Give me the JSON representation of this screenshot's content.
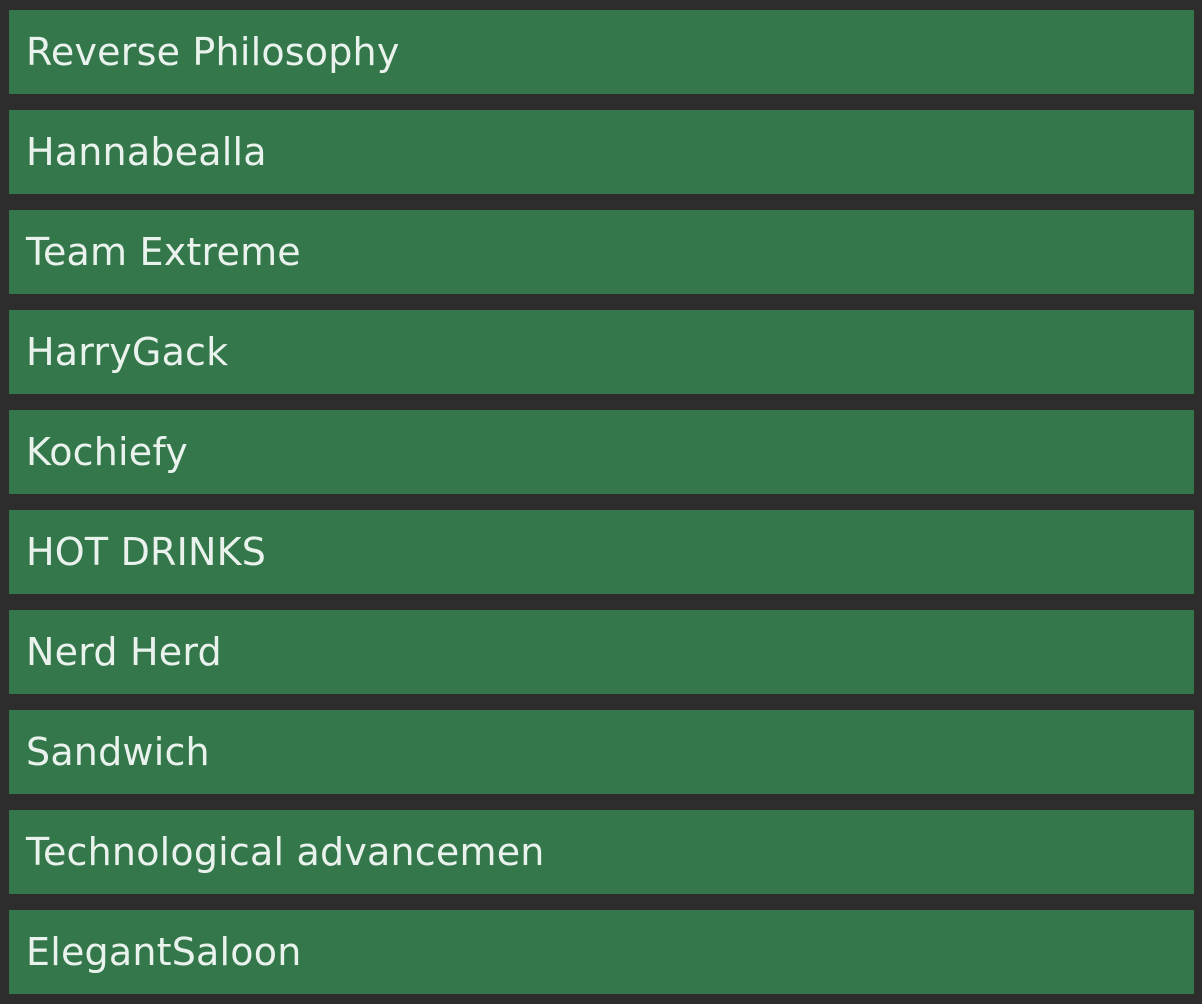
{
  "team_list": {
    "items": [
      {
        "label": "Reverse Philosophy"
      },
      {
        "label": "Hannabealla"
      },
      {
        "label": "Team Extreme"
      },
      {
        "label": "HarryGack"
      },
      {
        "label": "Kochiefy"
      },
      {
        "label": "HOT DRINKS"
      },
      {
        "label": "Nerd Herd"
      },
      {
        "label": "Sandwich"
      },
      {
        "label": "Technological advancemen"
      },
      {
        "label": "ElegantSaloon"
      }
    ]
  },
  "colors": {
    "background": "#2d2d2d",
    "item_background": "#33774a",
    "item_text": "#e9f2ec"
  }
}
